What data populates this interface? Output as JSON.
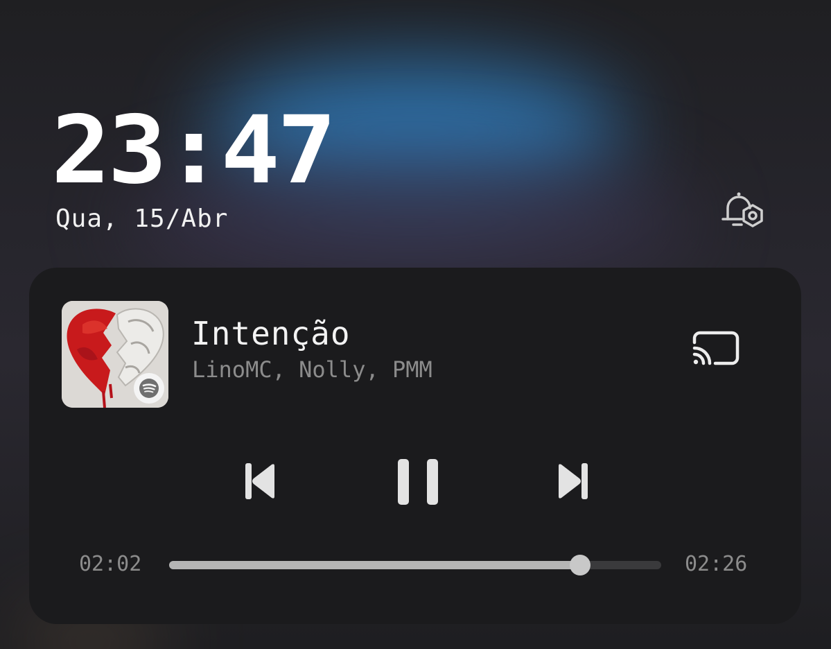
{
  "lockscreen": {
    "time": "23:47",
    "date": "Qua, 15/Abr"
  },
  "player": {
    "track_title": "Intenção",
    "artists": "LinoMC, Nolly, PMM",
    "elapsed": "02:02",
    "duration": "02:26",
    "progress": 0.8356,
    "state": "playing",
    "source_app_icon": "spotify-icon",
    "icons": {
      "alarm": "alarm-settings-icon",
      "cast": "cast-icon",
      "previous": "skip-previous-icon",
      "pause": "pause-icon",
      "next": "skip-next-icon"
    },
    "colors": {
      "card_bg": "#1b1b1d",
      "progress_fill": "#b5b5b5",
      "progress_track": "#3a3a3c",
      "secondary_text": "#8c8c8c"
    }
  }
}
